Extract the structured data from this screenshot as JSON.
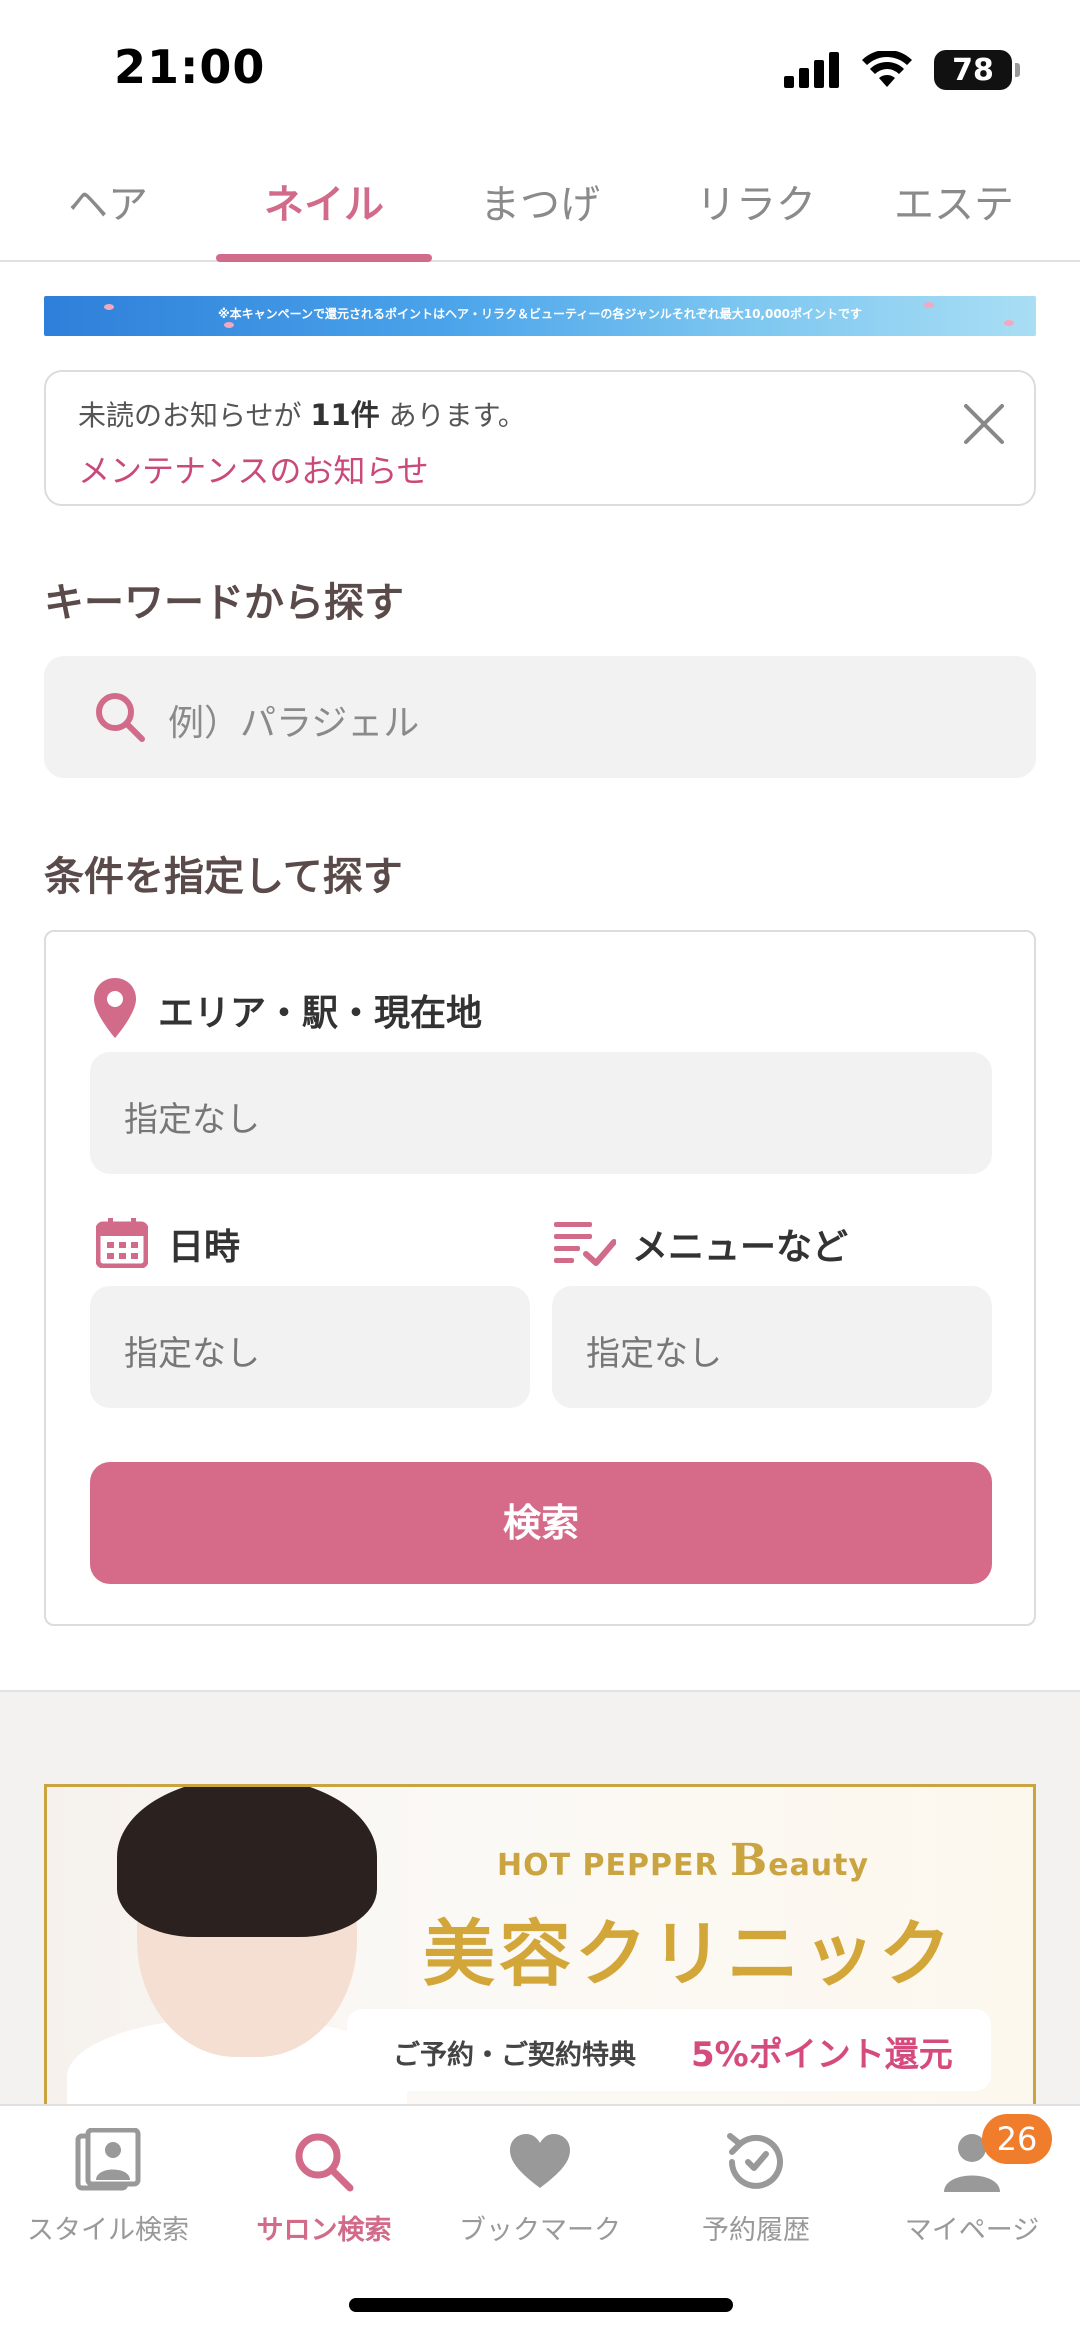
{
  "status_bar": {
    "time": "21:00",
    "battery": "78"
  },
  "genre_tabs": [
    {
      "label": "ヘア",
      "active": false
    },
    {
      "label": "ネイル",
      "active": true
    },
    {
      "label": "まつげ",
      "active": false
    },
    {
      "label": "リラク",
      "active": false
    },
    {
      "label": "エステ",
      "active": false
    }
  ],
  "campaign_banner": {
    "text": "※本キャンペーンで還元されるポイントはヘア・リラク＆ビューティーの各ジャンルそれぞれ最大10,000ポイントです"
  },
  "notice": {
    "prefix": "未読のお知らせが ",
    "count": "11件",
    "suffix": " あります。",
    "link": "メンテナンスのお知らせ"
  },
  "keyword_search": {
    "heading": "キーワードから探す",
    "placeholder": "例）パラジェル"
  },
  "conditions": {
    "heading": "条件を指定して探す",
    "area_label": "エリア・駅・現在地",
    "area_value": "指定なし",
    "date_label": "日時",
    "date_value": "指定なし",
    "menu_label": "メニューなど",
    "menu_value": "指定なし",
    "search_button": "検索"
  },
  "ad": {
    "brand_prefix": "HOT PEPPER ",
    "brand_b": "B",
    "brand_suffix": "eauty",
    "title": "美容クリニック",
    "pill_left": "ご予約・ご契約特典",
    "pill_right": "5%ポイント還元"
  },
  "bottom_nav": [
    {
      "label": "スタイル検索",
      "icon": "photo-icon",
      "active": false
    },
    {
      "label": "サロン検索",
      "icon": "search-icon",
      "active": true
    },
    {
      "label": "ブックマーク",
      "icon": "heart-icon",
      "active": false
    },
    {
      "label": "予約履歴",
      "icon": "history-icon",
      "active": false
    },
    {
      "label": "マイページ",
      "icon": "person-icon",
      "active": false,
      "badge": "26"
    }
  ],
  "colors": {
    "accent": "#d26a8a",
    "link": "#c94a7a",
    "button": "#d66a89",
    "gold": "#c9a441",
    "badge": "#f07d2c"
  }
}
